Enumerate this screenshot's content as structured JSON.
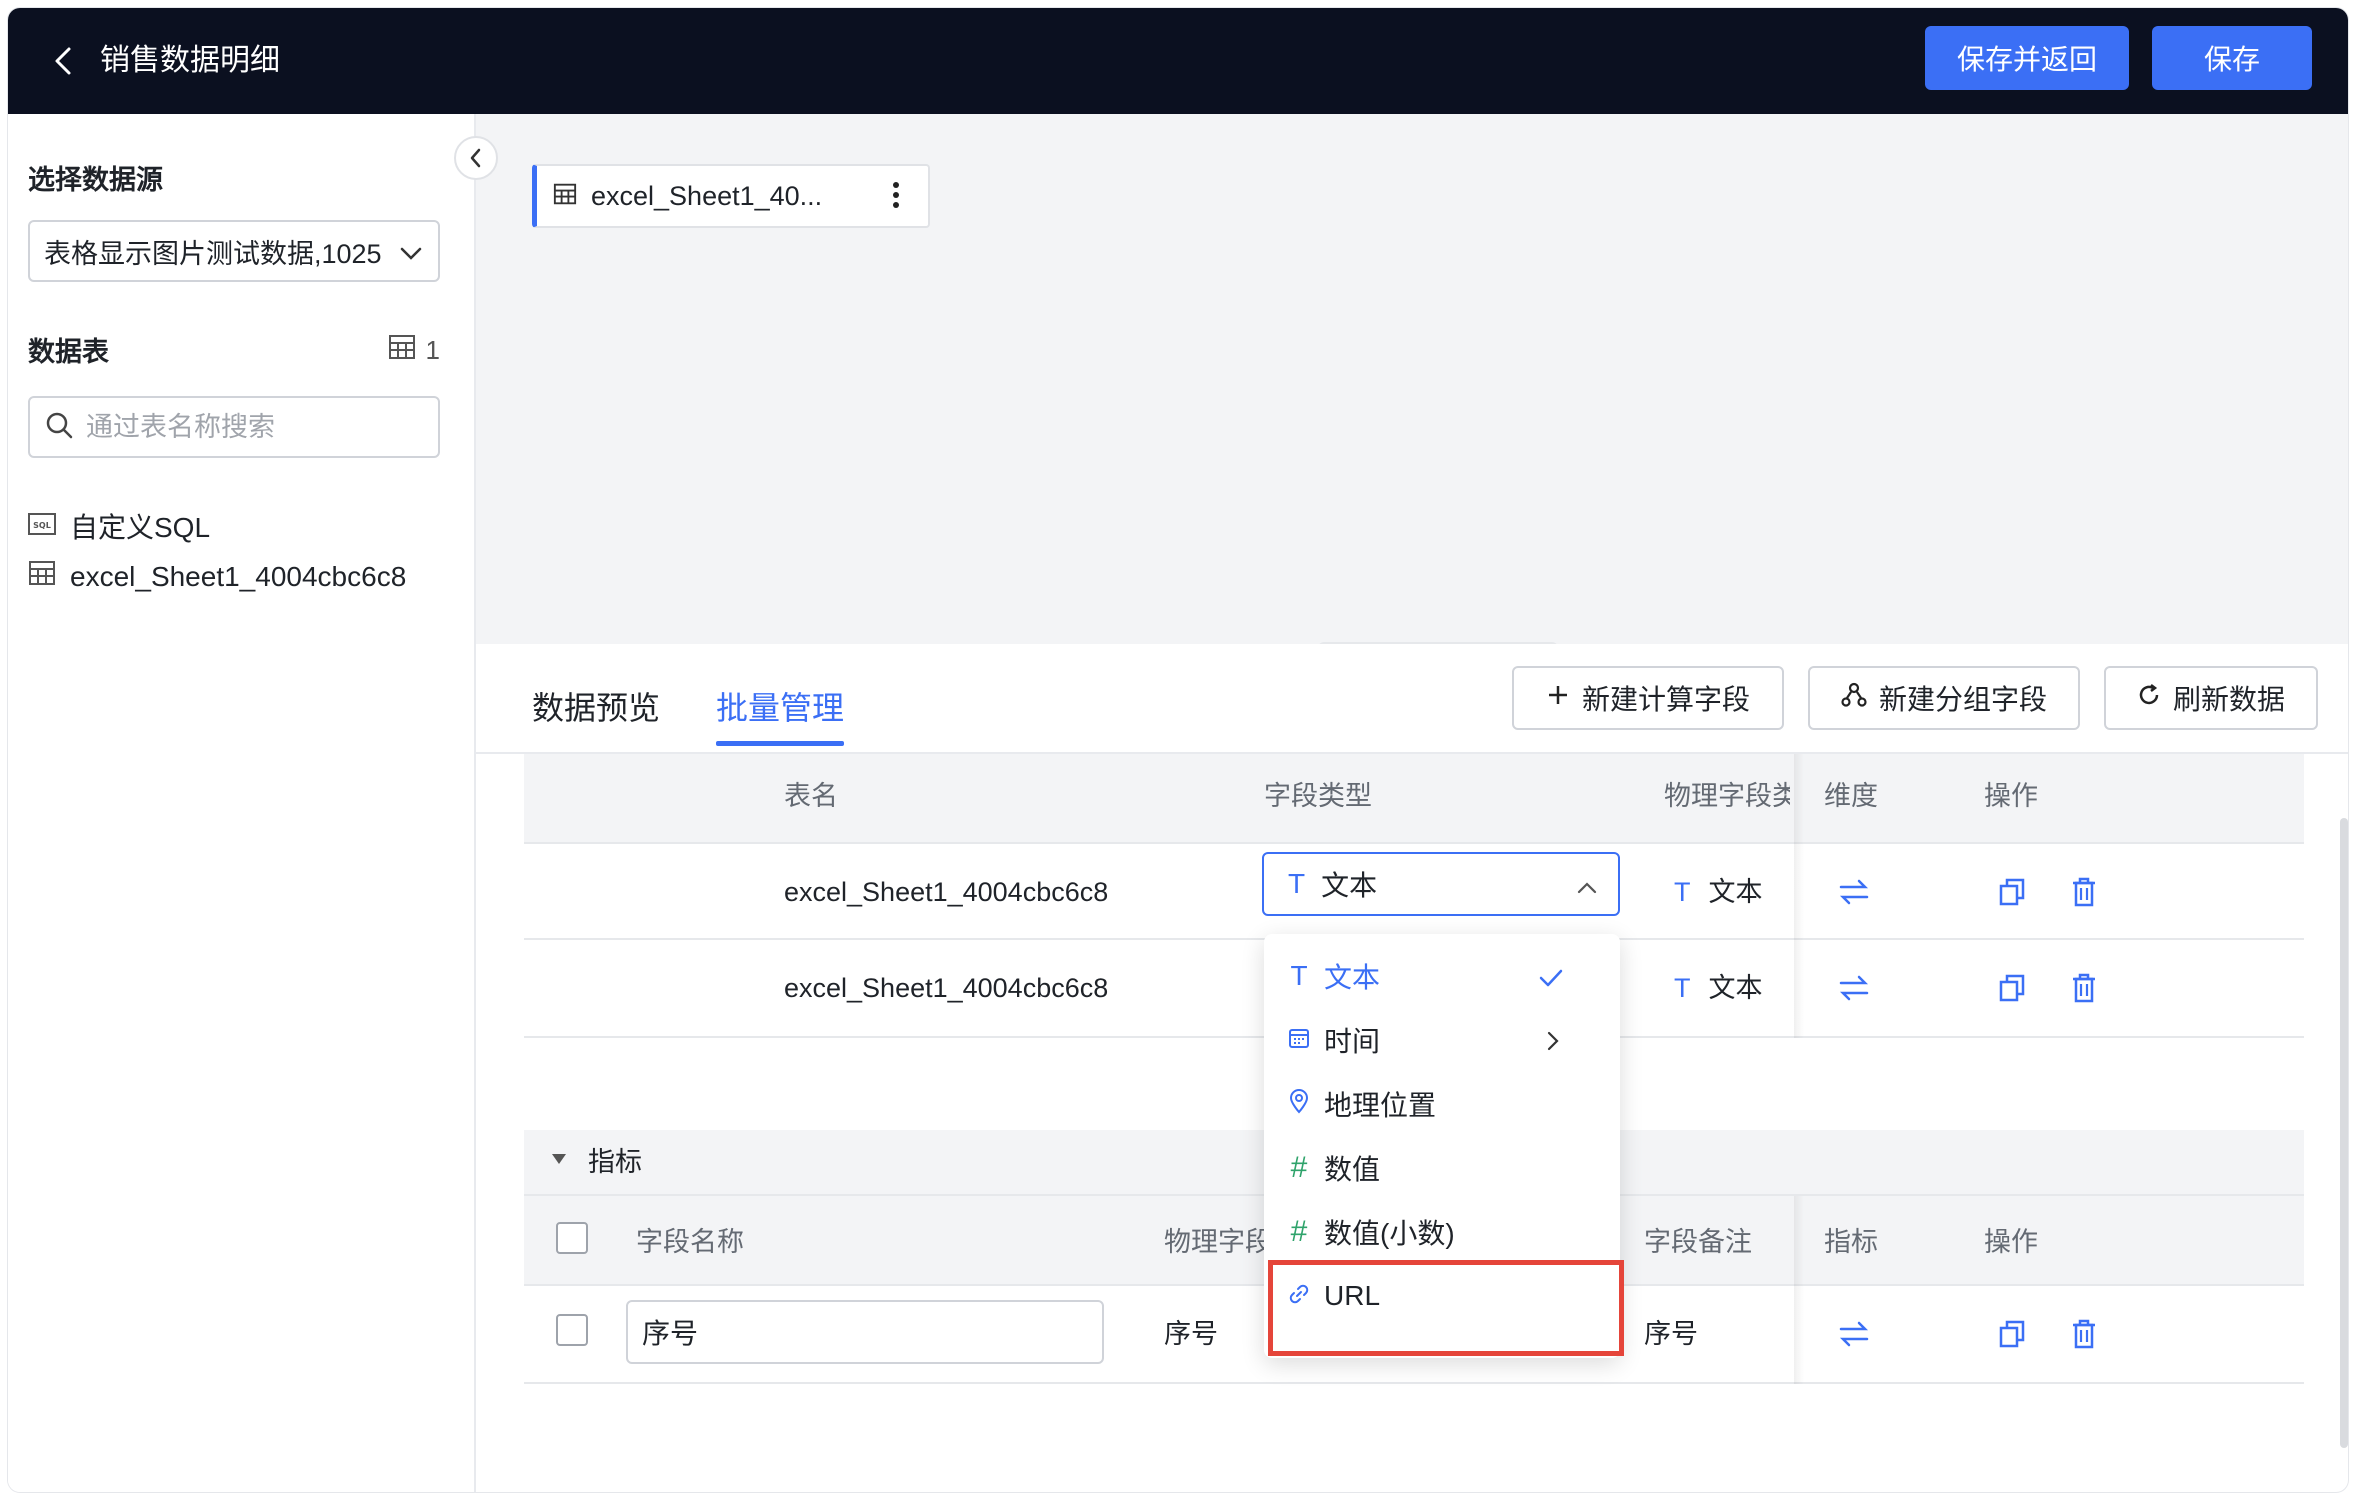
{
  "header": {
    "title": "销售数据明细",
    "save_return_label": "保存并返回",
    "save_label": "保存"
  },
  "sidebar": {
    "datasource_label": "选择数据源",
    "datasource_value": "表格显示图片测试数据,1025",
    "tables_label": "数据表",
    "tables_count": "1",
    "search_placeholder": "通过表名称搜索",
    "items": [
      {
        "label": "自定义SQL",
        "icon": "sql-icon"
      },
      {
        "label": "excel_Sheet1_4004cbc6c8",
        "icon": "table-icon"
      }
    ]
  },
  "canvas": {
    "table_chip_label": "excel_Sheet1_40..."
  },
  "tabs": [
    {
      "label": "数据预览",
      "active": false
    },
    {
      "label": "批量管理",
      "active": true
    }
  ],
  "actions": {
    "new_calc_field": "新建计算字段",
    "new_group_field": "新建分组字段",
    "refresh_data": "刷新数据"
  },
  "dimension_table": {
    "headers": [
      "表名",
      "字段类型",
      "物理字段类",
      "维度",
      "操作"
    ],
    "rows": [
      {
        "table_name": "excel_Sheet1_4004cbc6c8",
        "field_type": "文本",
        "physical_type": "文本"
      },
      {
        "table_name": "excel_Sheet1_4004cbc6c8",
        "field_type": "文本",
        "physical_type": "文本"
      }
    ]
  },
  "metrics_group": {
    "label": "指标",
    "headers": [
      "字段名称",
      "物理字段",
      "字段备注",
      "指标",
      "操作"
    ],
    "rows": [
      {
        "field_name": "序号",
        "physical_field": "序号",
        "remark": "序号"
      }
    ]
  },
  "type_dropdown": {
    "items": [
      {
        "label": "文本",
        "icon": "text-type-icon",
        "selected": true
      },
      {
        "label": "时间",
        "icon": "calendar-icon",
        "has_submenu": true
      },
      {
        "label": "地理位置",
        "icon": "location-pin-icon"
      },
      {
        "label": "数值",
        "icon": "hash-icon"
      },
      {
        "label": "数值(小数)",
        "icon": "hash-icon"
      },
      {
        "label": "URL",
        "icon": "link-icon",
        "highlighted": true
      }
    ]
  },
  "colors": {
    "header_bg": "#0b1020",
    "accent": "#3b6ff5",
    "highlight": "#e5453a",
    "number_icon": "#2fa36b"
  }
}
